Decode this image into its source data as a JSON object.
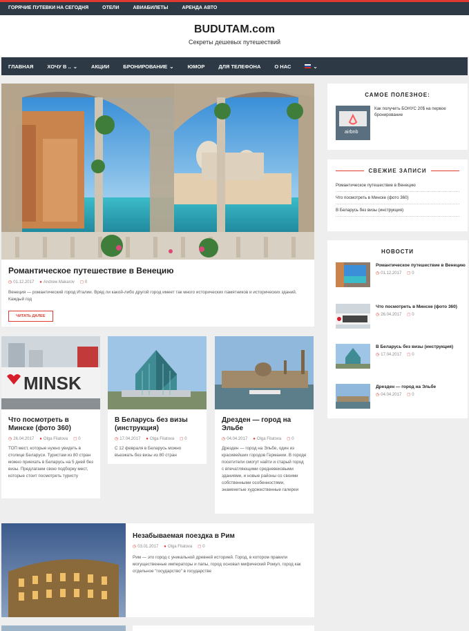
{
  "topbar": {
    "items": [
      "ГОРЯЧИЕ ПУТЕВКИ НА СЕГОДНЯ",
      "ОТЕЛИ",
      "АВИАБИЛЕТЫ",
      "АРЕНДА АВТО"
    ]
  },
  "header": {
    "title": "BUDUTAM.com",
    "tagline": "Секреты дешевых путешествий"
  },
  "nav": {
    "items": [
      "ГЛАВНАЯ",
      "ХОЧУ В ..",
      "АКЦИИ",
      "БРОНИРОВАНИЕ",
      "ЮМОР",
      "ДЛЯ ТЕЛЕФОНА",
      "О НАС"
    ],
    "chevron": "⌄"
  },
  "featured": {
    "title": "Романтическое путешествие в Венецию",
    "date": "01.12.2017",
    "author": "Andrew Makarov",
    "comments": "0",
    "excerpt": "Венеция — романтический город Италии. Вряд ли какой-либо другой город имеет так много исторических памятников и исторических зданий. Каждый год",
    "readmore": "ЧИТАТЬ ДАЛЕЕ"
  },
  "grid": [
    {
      "title": "Что посмотреть в Минске (фото 360)",
      "date": "26.04.2017",
      "author": "Olga Filatova",
      "comments": "0",
      "excerpt": "ТОП мест, которые нужно увидеть в столице Беларуси. Туристам из 80 стран можно приехать в Беларусь на 5 дней без визы. Предлагаем свою подборку мест, которые стоит посмотреть туристу",
      "image_text": "MINSK"
    },
    {
      "title": "В Беларусь без визы (инструкция)",
      "date": "17.04.2017",
      "author": "Olga Filatova",
      "comments": "0",
      "excerpt": "С 12 февраля в Беларусь можно въезжать без визы из 80 стран"
    },
    {
      "title": "Дрезден — город на Эльбе",
      "date": "04.04.2017",
      "author": "Olga Filatova",
      "comments": "0",
      "excerpt": "Дрезден — город на Эльбе, один из красивейших городов Германии. В городе посетители смогут найти и старый город с впечатляющими средневековыми зданиями, и новые районы со своими собственными особенностями, знаменитые художественные галереи"
    }
  ],
  "rome": {
    "title": "Незабываемая поездка в Рим",
    "date": "03.01.2017",
    "author": "Olga Filatova",
    "comments": "0",
    "excerpt": "Рим — это город с уникальной древней историей. Город, в котором правили могущественные императоры и папы, город основал мифический Ромул, город как отдельное \"государство\" в государстве"
  },
  "sidebar": {
    "useful": {
      "title": "САМОЕ ПОЛЕЗНОЕ:",
      "item": "Как получить БОНУС 20$ на первое бронирование",
      "logo": "airbnb"
    },
    "recent": {
      "title": "СВЕЖИЕ ЗАПИСИ",
      "items": [
        "Романтическое путешествие в Венецию",
        "Что посмотреть в Минске (фото 360)",
        "В Беларусь без визы (инструкция)"
      ]
    },
    "news": {
      "title": "НОВОСТИ",
      "items": [
        {
          "title": "Романтическое путешествие в Венецию",
          "date": "01.12.2017",
          "comments": "0"
        },
        {
          "title": "Что посмотреть в Минске (фото 360)",
          "date": "26.04.2017",
          "comments": "0"
        },
        {
          "title": "В Беларусь без визы (инструкция)",
          "date": "17.04.2017",
          "comments": "0"
        },
        {
          "title": "Дрезден — город на Эльбе",
          "date": "04.04.2017",
          "comments": "0"
        }
      ]
    }
  },
  "icons": {
    "clock": "clock-icon",
    "user": "user-icon",
    "comment": "comment-icon"
  },
  "colors": {
    "accent": "#e03a30",
    "nav": "#2d3a45"
  }
}
